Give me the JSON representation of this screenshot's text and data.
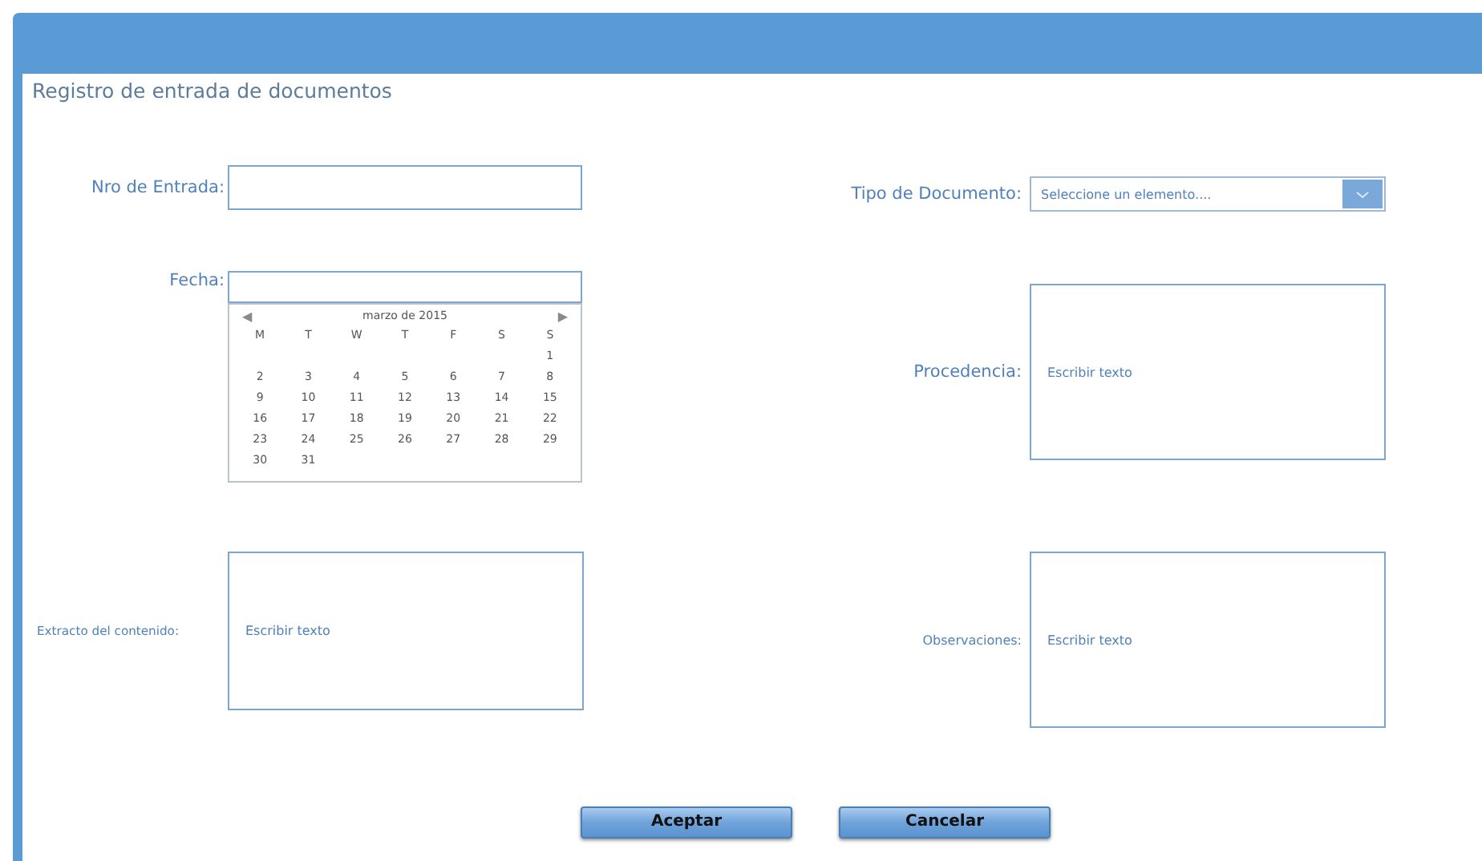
{
  "window": {
    "title": "Registro de entrada de documentos"
  },
  "left": [
    {
      "kind": "input",
      "label": "Nro de Entrada:"
    },
    {
      "kind": "date",
      "label": "Fecha:",
      "calendar": {
        "month": "marzo de 2015",
        "prev": "◀",
        "next": "▶",
        "weekdays": [
          "M",
          "T",
          "W",
          "T",
          "F",
          "S",
          "S"
        ],
        "weeks": [
          {
            "kind": "first",
            "days": [
              "1"
            ]
          },
          {
            "kind": "full",
            "days": [
              "2",
              "3",
              "4",
              "5",
              "6",
              "7",
              "8"
            ]
          },
          {
            "kind": "full",
            "days": [
              "9",
              "10",
              "11",
              "12",
              "13",
              "14",
              "15"
            ]
          },
          {
            "kind": "full",
            "days": [
              "16",
              "17",
              "18",
              "19",
              "20",
              "21",
              "22"
            ]
          },
          {
            "kind": "full",
            "days": [
              "23",
              "24",
              "25",
              "26",
              "27",
              "28",
              "29"
            ]
          },
          {
            "kind": "last",
            "days": [
              "30",
              "31"
            ]
          }
        ]
      }
    },
    {
      "kind": "textarea",
      "label": "Extracto del contenido:",
      "placeholder": "Escribir texto"
    }
  ],
  "right": [
    {
      "kind": "select",
      "label": "Tipo de Documento:",
      "placeholder": "Seleccione un elemento...."
    },
    {
      "kind": "textarea",
      "label": "Procedencia:",
      "placeholder": "Escribir texto"
    },
    {
      "kind": "textarea",
      "label": "Observaciones:",
      "placeholder": "Escribir texto"
    }
  ],
  "buttons": [
    "Aceptar",
    "Cancelar"
  ]
}
